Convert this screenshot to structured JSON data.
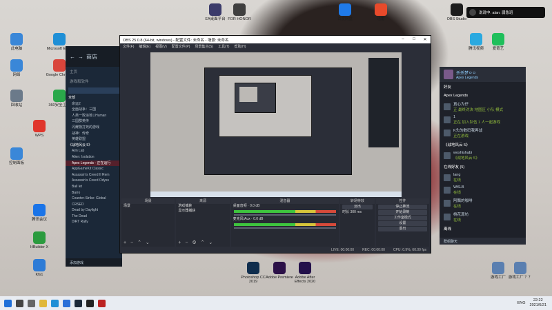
{
  "notification": {
    "text": "说说中: alan: 弱急班"
  },
  "desktop_icons": [
    {
      "label": "此电脑",
      "color": "#3a87d8"
    },
    {
      "label": "Microsoft Edge",
      "color": "#1f8fd6"
    },
    {
      "label": "网络",
      "color": "#3a87d8"
    },
    {
      "label": "Google Chrome",
      "color": "#d9453b"
    },
    {
      "label": "回收站",
      "color": "#6b7a8a"
    },
    {
      "label": "360安全卫士",
      "color": "#2aa84a"
    },
    {
      "label": "WPS",
      "color": "#e0352b"
    },
    {
      "label": "控制面板",
      "color": "#3a87d8"
    },
    {
      "label": "腾讯会议",
      "color": "#1a74e8"
    },
    {
      "label": "HBuilder X",
      "color": "#2b9b3e"
    },
    {
      "label": "Kfs1",
      "color": "#2d7bd6"
    },
    {
      "label": "EA桌面平台",
      "color": "#3b3b6b"
    },
    {
      "label": "FOR HONOR",
      "color": "#3f3f3f"
    },
    {
      "label": "百度网盘",
      "color": "#1f7ae8"
    },
    {
      "label": "迅雷",
      "color": "#e84a2b"
    },
    {
      "label": "OBS Studio",
      "color": "#1d1d1d"
    },
    {
      "label": "腾讯视频",
      "color": "#2aa9e0"
    },
    {
      "label": "爱奇艺",
      "color": "#1fbf5b"
    },
    {
      "label": "Photoshop CC 2019",
      "color": "#0f2d4d"
    },
    {
      "label": "Adobe Premiere",
      "color": "#2b1047"
    },
    {
      "label": "Adobe After Effects 2020",
      "color": "#23104a"
    },
    {
      "label": "游戏工厂",
      "color": "#5a7fb0"
    },
    {
      "label": "游戏工厂 ？？",
      "color": "#5a7fb0"
    }
  ],
  "steam": {
    "nav_title": "商店",
    "home_label": "主页",
    "section_label": "游戏和软件",
    "games": [
      {
        "name": "全部",
        "type": "hdr"
      },
      {
        "name": "命运2",
        "type": ""
      },
      {
        "name": "全面战争：三国",
        "type": ""
      },
      {
        "name": "人类一败涂地 | Human",
        "type": ""
      },
      {
        "name": "三国群英传",
        "type": ""
      },
      {
        "name": "闪耀物打死的游戏",
        "type": ""
      },
      {
        "name": "战神：传奇",
        "type": ""
      },
      {
        "name": "英雄联盟",
        "type": ""
      },
      {
        "name": "《战地风云 5》",
        "type": "hdr"
      },
      {
        "name": "Aim Lab",
        "type": ""
      },
      {
        "name": "Alien: Isolation",
        "type": ""
      },
      {
        "name": "Apex Legends - 正在运行",
        "type": "apex"
      },
      {
        "name": "AppGameKit Classic",
        "type": ""
      },
      {
        "name": "Assassin's Creed II Rem",
        "type": ""
      },
      {
        "name": "Assassin's Creed Odyss",
        "type": ""
      },
      {
        "name": "Ball let",
        "type": ""
      },
      {
        "name": "Barro",
        "type": ""
      },
      {
        "name": "Counter-Strike: Global",
        "type": ""
      },
      {
        "name": "CRSED",
        "type": ""
      },
      {
        "name": "Dead by Daylight",
        "type": ""
      },
      {
        "name": "The Dead",
        "type": ""
      },
      {
        "name": "DiRT Rally",
        "type": ""
      }
    ],
    "bottom_label": "添加游戏"
  },
  "obs": {
    "title": "OBS 25.0.8 (64-bit, windows) - 配置文件: 未命名 - 场景: 未命名",
    "menu": [
      "文件(F)",
      "编辑(E)",
      "视图(V)",
      "配置文件(P)",
      "场景集合(S)",
      "工具(T)",
      "帮助(H)"
    ],
    "docks": {
      "scenes": {
        "title": "场景",
        "items": [
          "场景"
        ]
      },
      "sources": {
        "title": "来源",
        "items": [
          "游戏捕获",
          "显示器捕获"
        ]
      },
      "mixer": {
        "title": "混音器",
        "ch1": "桌面音频",
        "ch1_db": "0.0 dB",
        "ch2": "麦克风/Aux",
        "ch2_db": "0.0 dB"
      },
      "transitions": {
        "title": "转场特效",
        "type": "淡出",
        "duration_label": "时长",
        "duration": "300 ms"
      },
      "controls": {
        "title": "控件",
        "buttons": [
          "停止推流",
          "开始录制",
          "工作室模式",
          "设置",
          "退出"
        ]
      }
    },
    "status": {
      "live": "LIVE: 00:00:00",
      "rec": "REC: 00:00:00",
      "cpu": "CPU: 0.9%, 60.00 fps"
    }
  },
  "friends": {
    "name": "杀杀梦ㅇㅇ",
    "status": "Apex Legends",
    "tab": "好友",
    "group_title": "Apex Legends",
    "playing": [
      {
        "name": "真心为仔",
        "game": "正 最终对决 地图区 小队 模式"
      },
      {
        "name": "1",
        "game": "正在 加入队伍 1 人一起游戏"
      },
      {
        "name": "K头的数码我再战",
        "game": "正在游戏"
      }
    ],
    "group2_title": "《战地风云 5》",
    "group2": [
      {
        "name": "woshishabi",
        "game": "《战地风云 5》"
      }
    ],
    "online_title": "在线好友 (5)",
    "online": [
      {
        "name": "lang",
        "game": "在线"
      },
      {
        "name": "WKLB",
        "game": "在线"
      },
      {
        "name": "阿飘的咖啡",
        "game": "在线"
      },
      {
        "name": "桃花源坊",
        "game": "在线"
      }
    ],
    "offline_title": "离线",
    "chat_label": "群组聊天"
  },
  "taskbar": {
    "lang": "ENG",
    "time": "22:22",
    "date": "2021/6/21"
  },
  "colors": {
    "obs_bg": "#2b2e38",
    "steam_bg": "#1b2838",
    "taskbar": "#e8ecf2"
  }
}
